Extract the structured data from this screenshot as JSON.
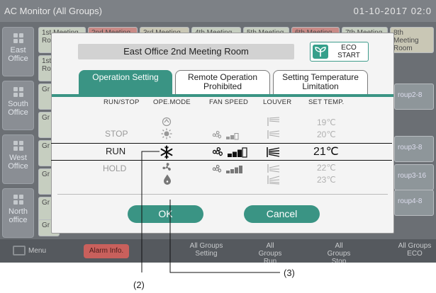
{
  "app": {
    "title": "AC Monitor (All Groups)",
    "clock": "01-10-2017  02:0",
    "areas": [
      {
        "label": "East Office"
      },
      {
        "label": "South Office"
      },
      {
        "label": "West Office"
      },
      {
        "label": "North office"
      }
    ],
    "top_row": [
      "1st Meeting Room",
      "2nd Meeting",
      "3rd Meeting",
      "4th Meeting",
      "5th Meeting",
      "6th Meeting",
      "7th Meeting",
      "8th Meeting Room"
    ],
    "row1_sub": "1st Ro",
    "group_cells": [
      "Gr",
      "Gr",
      "Gr",
      "Gr",
      "Gr",
      "Gr"
    ],
    "right_cells": [
      "roup2-8",
      "roup3-8",
      "roup3-16",
      "roup4-8"
    ],
    "bottom": {
      "menu": "Menu",
      "alarm": "Alarm Info.",
      "all_setting": "All Groups Setting",
      "all_run": "All Groups Run",
      "all_stop": "All Groups Stop",
      "all_eco": "All Groups ECO"
    }
  },
  "dialog": {
    "room_name": "East Office 2nd Meeting Room",
    "eco_label": "ECO START",
    "tabs": [
      {
        "label": "Operation Setting",
        "active": true
      },
      {
        "label": "Remote Operation Prohibited",
        "active": false
      },
      {
        "label": "Setting Temperature Limitation",
        "active": false
      }
    ],
    "columns": [
      "RUN/STOP",
      "OPE.MODE",
      "FAN SPEED",
      "LOUVER",
      "SET TEMP."
    ],
    "run_stop": {
      "above": "STOP",
      "selected": "RUN",
      "below": "HOLD"
    },
    "mode_icons": [
      "auto-icon",
      "heat-icon",
      "cool-icon",
      "fan-icon",
      "dry-icon"
    ],
    "selected_mode": "cool-icon",
    "fan_levels_shown": [
      2,
      3,
      4
    ],
    "selected_fan_level": 3,
    "temperatures": [
      "19℃",
      "20℃",
      "21℃",
      "22℃",
      "23℃"
    ],
    "selected_temperature": "21℃",
    "ok_label": "OK",
    "cancel_label": "Cancel"
  },
  "callouts": {
    "left": "(2)",
    "right": "(3)"
  }
}
